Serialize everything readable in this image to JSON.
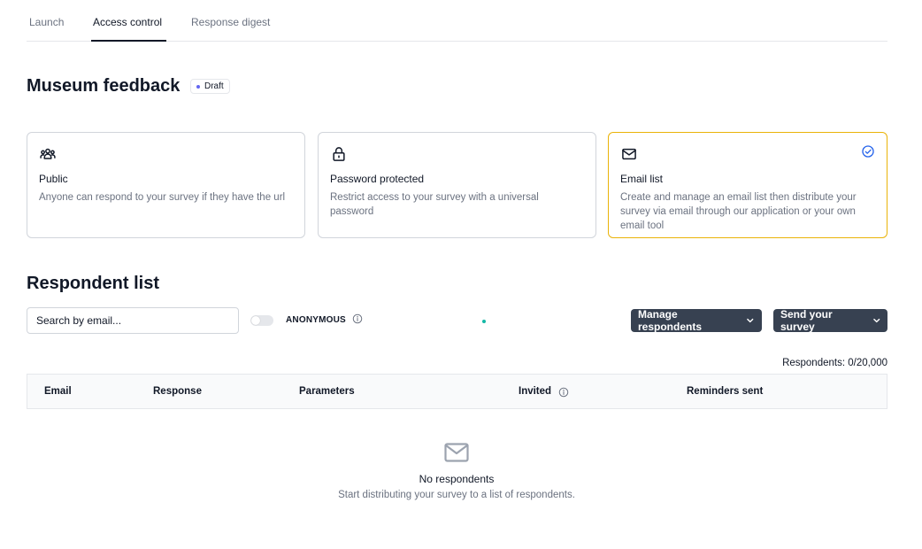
{
  "tabs": [
    {
      "label": "Launch",
      "active": false
    },
    {
      "label": "Access control",
      "active": true
    },
    {
      "label": "Response digest",
      "active": false
    }
  ],
  "survey": {
    "title": "Museum feedback",
    "status": "Draft"
  },
  "access_options": [
    {
      "icon": "users-icon",
      "title": "Public",
      "description": "Anyone can respond to your survey if they have the url",
      "selected": false
    },
    {
      "icon": "lock-icon",
      "title": "Password protected",
      "description": "Restrict access to your survey with a universal password",
      "selected": false
    },
    {
      "icon": "mail-icon",
      "title": "Email list",
      "description": "Create and manage an email list then distribute your survey via email through our application or your own email tool",
      "selected": true
    }
  ],
  "respondents": {
    "title": "Respondent list",
    "search_placeholder": "Search by email...",
    "anonymous_label": "ANONYMOUS",
    "anonymous_enabled": false,
    "manage_button": "Manage respondents",
    "send_button": "Send your survey",
    "count_label": "Respondents: 0/20,000",
    "columns": [
      "Email",
      "Response",
      "Parameters",
      "Invited",
      "Reminders sent"
    ],
    "empty_title": "No respondents",
    "empty_description": "Start distributing your survey to a list of respondents."
  },
  "colors": {
    "accent_selected_border": "#eab308",
    "check": "#2563eb",
    "button_bg": "#374151",
    "draft_dot": "#6366f1"
  }
}
